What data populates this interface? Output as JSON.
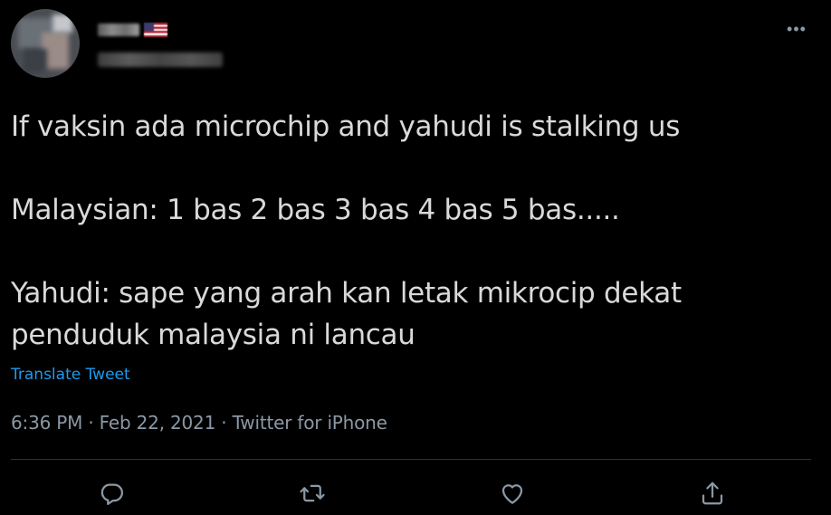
{
  "tweet": {
    "lines": [
      "If vaksin ada microchip and yahudi is stalking us",
      "",
      "Malaysian: 1 bas 2 bas 3 bas 4 bas 5 bas.....",
      "",
      "Yahudi: sape yang arah kan letak mikrocip dekat",
      "penduduk malaysia ni lancau"
    ],
    "translate_label": "Translate Tweet",
    "time": "6:36 PM",
    "separator": " · ",
    "date": "Feb 22, 2021",
    "client": "Twitter for iPhone"
  },
  "colors": {
    "background": "#000000",
    "text": "#d9d9d9",
    "secondary": "#8b98a5",
    "link": "#1d9bf0",
    "divider": "#2f3336"
  },
  "icons": {
    "more": "more-icon",
    "reply": "reply-icon",
    "retweet": "retweet-icon",
    "like": "heart-icon",
    "share": "share-icon"
  }
}
